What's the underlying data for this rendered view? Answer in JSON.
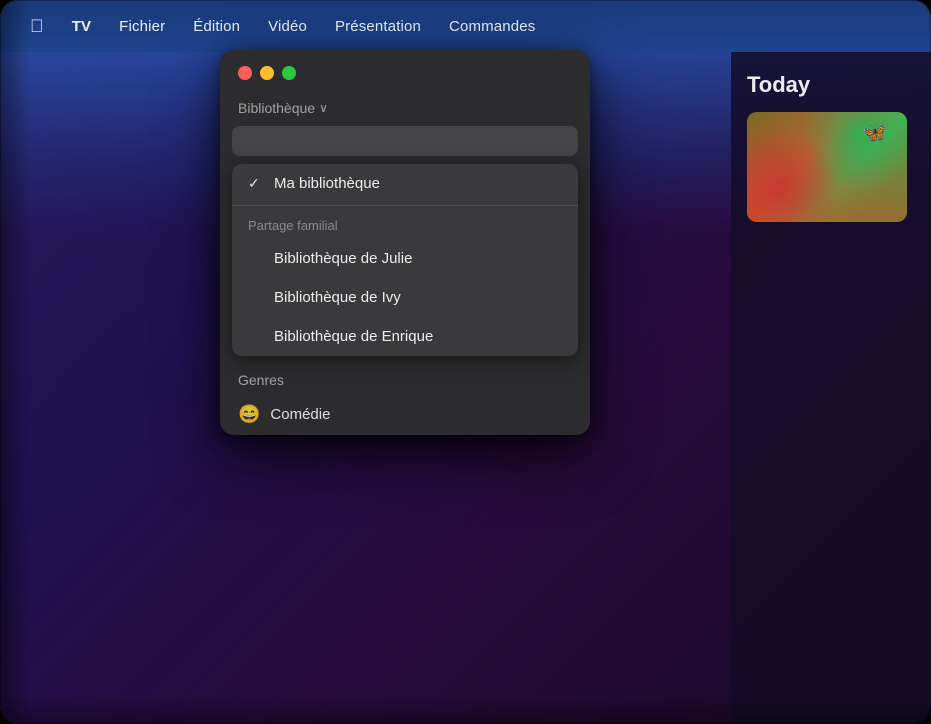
{
  "screen": {
    "border_radius": "18px"
  },
  "menu_bar": {
    "apple_logo": "",
    "items": [
      {
        "id": "tv",
        "label": "TV",
        "bold": true
      },
      {
        "id": "fichier",
        "label": "Fichier"
      },
      {
        "id": "edition",
        "label": "Édition"
      },
      {
        "id": "video",
        "label": "Vidéo"
      },
      {
        "id": "presentation",
        "label": "Présentation"
      },
      {
        "id": "commandes",
        "label": "Commandes"
      }
    ]
  },
  "floating_window": {
    "traffic_lights": {
      "close_label": "",
      "minimize_label": "",
      "maximize_label": ""
    },
    "library_header": "Bibliothèque",
    "library_chevron": "∨",
    "dropdown": {
      "selected_item": "Ma bibliothèque",
      "section_label": "Partage familial",
      "items": [
        {
          "id": "ma-bibliotheque",
          "label": "Ma bibliothèque",
          "selected": true
        },
        {
          "id": "julie",
          "label": "Bibliothèque de Julie",
          "selected": false
        },
        {
          "id": "ivy",
          "label": "Bibliothèque de Ivy",
          "selected": false
        },
        {
          "id": "enrique",
          "label": "Bibliothèque de Enrique",
          "selected": false
        }
      ]
    },
    "genres_label": "Genres",
    "genres": [
      {
        "id": "comedie",
        "label": "Comédie",
        "icon": "😄"
      }
    ]
  },
  "right_panel": {
    "today_label": "Today"
  },
  "colors": {
    "menu_bar_bg": "#1a3a7a",
    "window_bg": "#2c2c2e",
    "dropdown_bg": "#3a3a3c",
    "close": "#ff5f57",
    "minimize": "#febc2e",
    "maximize": "#28c840",
    "text_primary": "rgba(255,255,255,0.90)",
    "text_secondary": "rgba(255,255,255,0.55)"
  }
}
